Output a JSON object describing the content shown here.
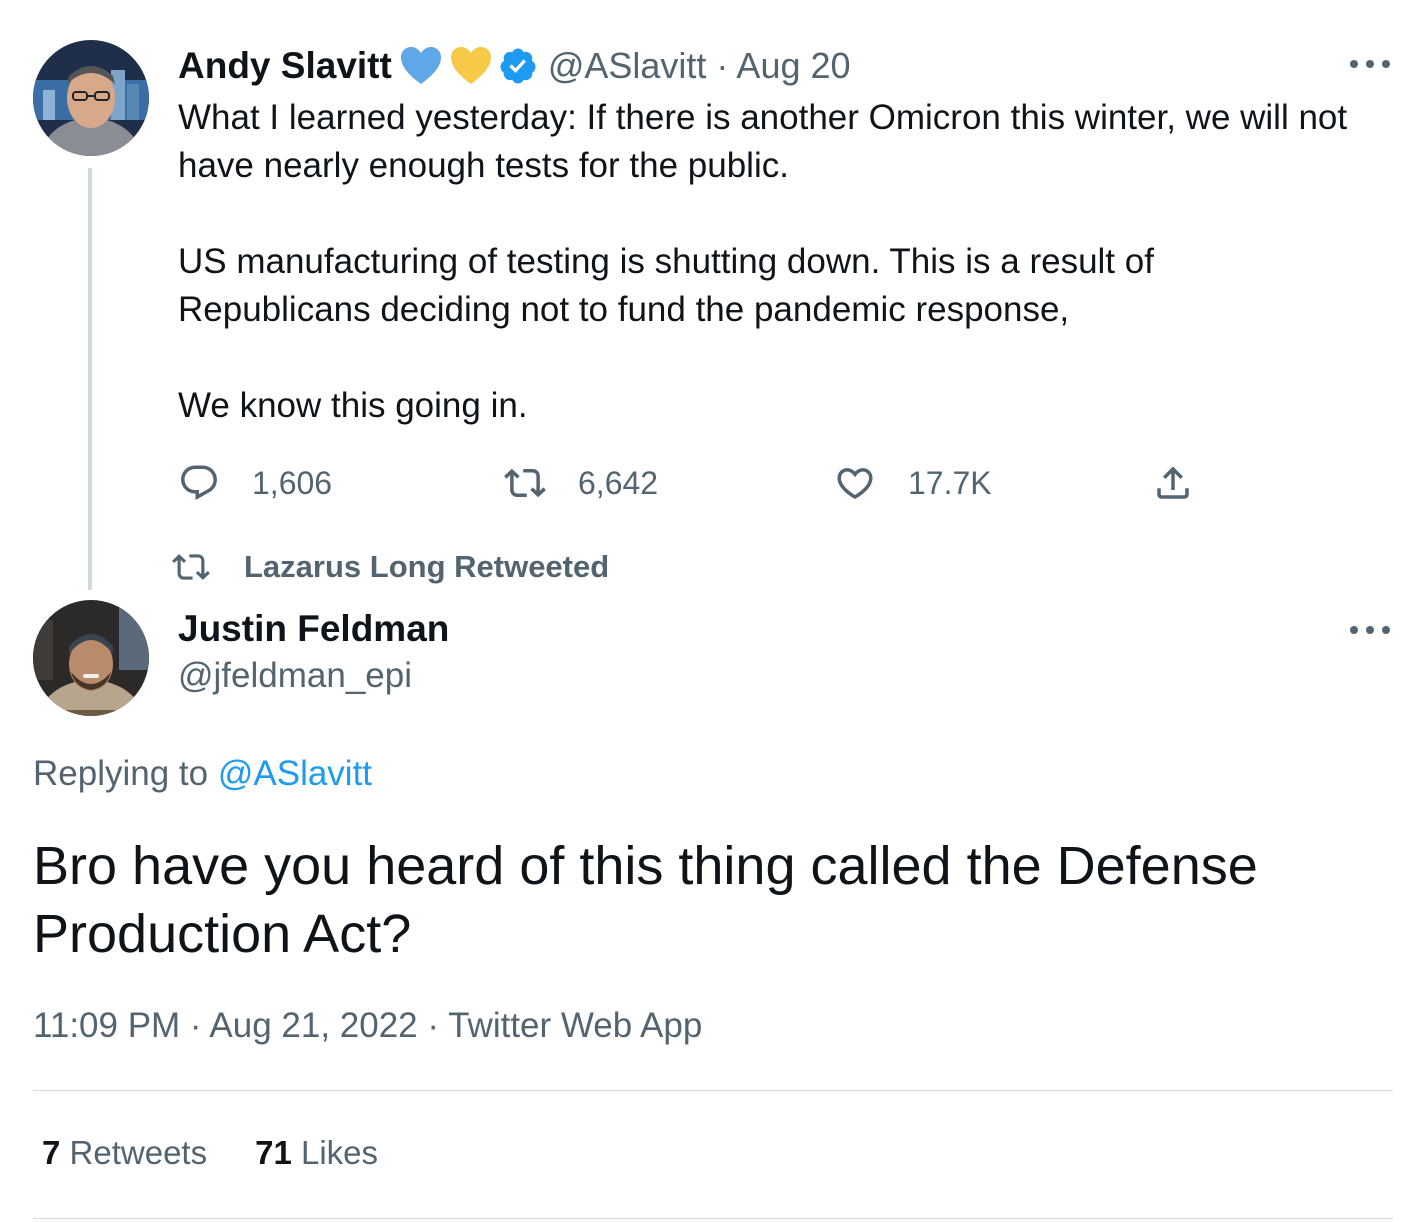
{
  "tweet1": {
    "name": "Andy Slavitt",
    "handle": "@ASlavitt",
    "date": "· Aug 20",
    "paragraphs": [
      "What I learned yesterday: If there is another Omicron this winter, we will not have nearly enough tests for the public.",
      "US manufacturing of testing is shutting down. This is a result of Republicans deciding not to fund the pandemic response,",
      "We know this going in."
    ],
    "replies": "1,606",
    "retweets": "6,642",
    "likes": "17.7K",
    "heart_colors": [
      "#5fa8e8",
      "#f7c948"
    ]
  },
  "retweet_context": {
    "text": "Lazarus Long Retweeted"
  },
  "tweet2": {
    "name": "Justin Feldman",
    "handle": "@jfeldman_epi",
    "replying_prefix": "Replying to",
    "replying_handle": "@ASlavitt",
    "text": "Bro have you heard of this thing called the Defense Production Act?",
    "timestamp": "11:09 PM · Aug 21, 2022 · Twitter Web App",
    "retweet_count": "7",
    "retweet_label": "Retweets",
    "like_count": "71",
    "like_label": "Likes"
  },
  "colors": {
    "accent": "#1d9bf0",
    "muted": "#536471",
    "text": "#0f1419",
    "border": "#cfd9de"
  }
}
